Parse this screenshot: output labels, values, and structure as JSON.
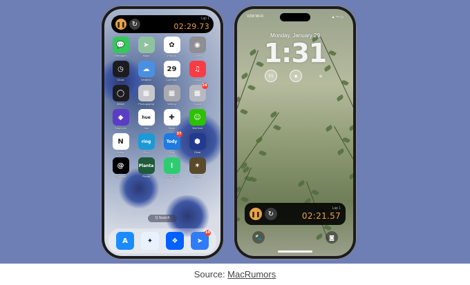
{
  "caption": {
    "prefix": "Source: ",
    "link": "MacRumors"
  },
  "left_phone": {
    "activity": {
      "lap": "Lap 1",
      "time": "02:29.73"
    },
    "apps": [
      {
        "label": "Messages",
        "glyph": "💬",
        "color": "#34c759",
        "badge": ""
      },
      {
        "label": "Maps",
        "glyph": "➤",
        "color": "#8fc3a0",
        "badge": ""
      },
      {
        "label": "Photos",
        "glyph": "✿",
        "color": "#ffffff",
        "badge": ""
      },
      {
        "label": "Camera",
        "glyph": "◉",
        "color": "#8e8e93",
        "badge": ""
      },
      {
        "label": "Clock",
        "glyph": "◷",
        "color": "#1c1c1e",
        "badge": ""
      },
      {
        "label": "Weather",
        "glyph": "☁",
        "color": "#4a90e2",
        "badge": ""
      },
      {
        "label": "Calendar",
        "glyph": "29",
        "color": "#ffffff",
        "badge": ""
      },
      {
        "label": "Music",
        "glyph": "♫",
        "color": "#fc3c44",
        "badge": ""
      },
      {
        "label": "Watch",
        "glyph": "◯",
        "color": "#1c1c1e",
        "badge": ""
      },
      {
        "label": "Photography",
        "glyph": "▦",
        "color": "#c7c7cc",
        "badge": ""
      },
      {
        "label": "Writing",
        "glyph": "▦",
        "color": "#a9a9b0",
        "badge": ""
      },
      {
        "label": "Social",
        "glyph": "▦",
        "color": "#b8b8c0",
        "badge": "24"
      },
      {
        "label": "Shortcuts",
        "glyph": "◆",
        "color": "#5b3cc4",
        "badge": ""
      },
      {
        "label": "Hue",
        "glyph": "hue",
        "color": "#ffffff",
        "badge": ""
      },
      {
        "label": "Slack",
        "glyph": "✚",
        "color": "#ffffff",
        "badge": ""
      },
      {
        "label": "WeChat",
        "glyph": "☺",
        "color": "#2dc100",
        "badge": ""
      },
      {
        "label": "Notion",
        "glyph": "N",
        "color": "#ffffff",
        "badge": ""
      },
      {
        "label": "Ring",
        "glyph": "ring",
        "color": "#1c9ad6",
        "badge": ""
      },
      {
        "label": "Tody",
        "glyph": "Tody",
        "color": "#1e7be0",
        "badge": "37"
      },
      {
        "label": "Clear",
        "glyph": "⬢",
        "color": "#223a8f",
        "badge": ""
      },
      {
        "label": "Threads",
        "glyph": "@",
        "color": "#000000",
        "badge": ""
      },
      {
        "label": "Planta",
        "glyph": "Planta",
        "color": "#1f5a3a",
        "badge": ""
      },
      {
        "label": "ScreenPush",
        "glyph": "!",
        "color": "#2ecc71",
        "badge": ""
      },
      {
        "label": "Clear",
        "glyph": "✶",
        "color": "#5b4a2a",
        "badge": ""
      }
    ],
    "search": "Q Search",
    "dock": [
      {
        "label": "App Store",
        "glyph": "A",
        "color": "#1a8cff",
        "badge": ""
      },
      {
        "label": "Safari",
        "glyph": "✦",
        "color": "#e8f2ff",
        "badge": ""
      },
      {
        "label": "Dropbox",
        "glyph": "❖",
        "color": "#0061fe",
        "badge": ""
      },
      {
        "label": "Spark",
        "glyph": "➤",
        "color": "#2f7cf6",
        "badge": "10"
      }
    ]
  },
  "right_phone": {
    "status_left": "VZW Wi-Fi",
    "status_right": "▲ 〜 ▭",
    "date": "Monday, January 29",
    "clock": "1:31",
    "widgets": [
      "55",
      "◉",
      "≡"
    ],
    "activity": {
      "lap": "Lap 1",
      "time": "02:21.57"
    },
    "flashlight": "🔦",
    "camera": "◙"
  }
}
